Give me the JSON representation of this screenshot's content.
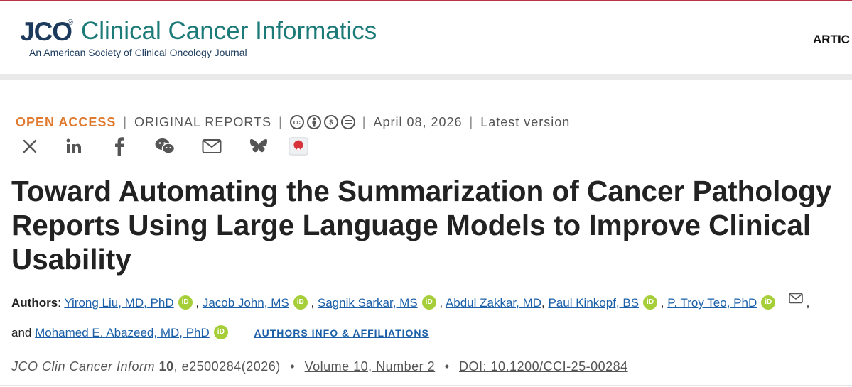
{
  "header": {
    "logo_short": "JCO",
    "logo_registered": "®",
    "logo_journal": "Clinical Cancer Informatics",
    "logo_subtitle": "An American Society of Clinical Oncology Journal",
    "nav_partial": "ARTIC"
  },
  "meta": {
    "access": "OPEN ACCESS",
    "separator": "|",
    "section": "ORIGINAL REPORTS",
    "license_icons": [
      "cc-icon",
      "by-icon",
      "nc-icon",
      "nd-icon"
    ],
    "date": "April 08, 2026",
    "version": "Latest version"
  },
  "share_icons": [
    "x-icon",
    "linkedin-icon",
    "facebook-icon",
    "wechat-icon",
    "email-icon",
    "bluesky-icon",
    "mendeley-icon"
  ],
  "article": {
    "title": "Toward Automating the Summarization of Cancer Pathology Reports Using Large Language Models to Improve Clinical Usability"
  },
  "authors": {
    "label": "Authors",
    "list": [
      "Yirong Liu, MD, PhD",
      "Jacob John, MS",
      "Sagnik Sarkar, MS",
      "Abdul Zakkar, MD",
      "Paul Kinkopf, BS",
      "P. Troy Teo, PhD",
      "Mohamed E. Abazeed, MD, PhD"
    ],
    "and_word": "and",
    "orcid_badge": "iD",
    "affiliations_link": "AUTHORS INFO & AFFILIATIONS"
  },
  "citation": {
    "journal_abbrev": "JCO Clin Cancer Inform",
    "volume": "10",
    "article_id": "e2500284(2026)",
    "bullet": "•",
    "issue_link": "Volume 10, Number 2",
    "doi_link": "DOI: 10.1200/CCI-25-00284"
  },
  "colors": {
    "brand_navy": "#1b3a5c",
    "brand_teal": "#1c7a78",
    "open_access": "#e07a2f",
    "link": "#1a5fa8",
    "orcid": "#a6ce39"
  }
}
